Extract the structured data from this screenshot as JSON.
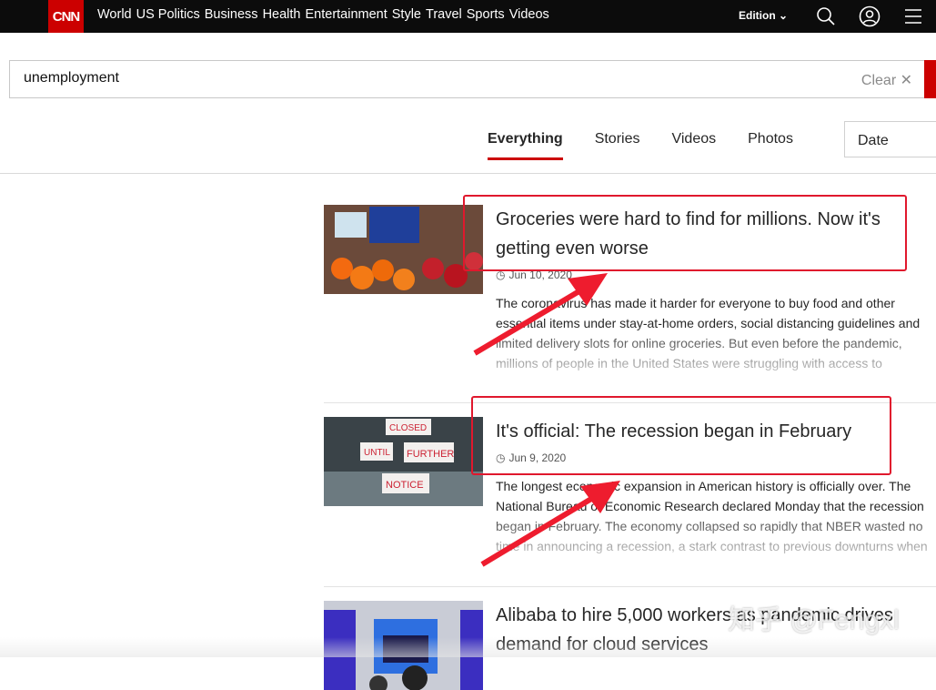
{
  "nav": {
    "logo": "CNN",
    "links": [
      "World",
      "US Politics",
      "Business",
      "Health",
      "Entertainment",
      "Style",
      "Travel",
      "Sports",
      "Videos"
    ],
    "edition": "Edition",
    "icons": [
      "search-icon",
      "user-icon",
      "menu-icon"
    ]
  },
  "search": {
    "value": "unemployment",
    "clear_label": "Clear"
  },
  "tabs": [
    {
      "label": "Everything",
      "active": true
    },
    {
      "label": "Stories"
    },
    {
      "label": "Videos"
    },
    {
      "label": "Photos"
    }
  ],
  "sort": {
    "selected": "Date"
  },
  "results": [
    {
      "title": "Groceries were hard to find for millions. Now it's getting even worse",
      "date": "Jun 10, 2020",
      "body": "The coronavirus has made it harder for everyone to buy food and other essential items under stay-at-home orders, social distancing guidelines and limited delivery slots for online groceries. But even before the pandemic, millions of people in the United States were struggling with access to groceries."
    },
    {
      "title": "It's official: The recession began in February",
      "date": "Jun 9, 2020",
      "body": "The longest economic expansion in American history is officially over. The National Bureau of Economic Research declared Monday that the recession began in February. The economy collapsed so rapidly that NBER wasted no time in announcing a recession, a stark contrast to previous downturns when"
    },
    {
      "title": "Alibaba to hire 5,000 workers as pandemic drives demand for cloud services"
    }
  ],
  "annotation_color": "#e0182d",
  "brand_color": "#cc0000",
  "watermark": "知乎 @Fengxl"
}
